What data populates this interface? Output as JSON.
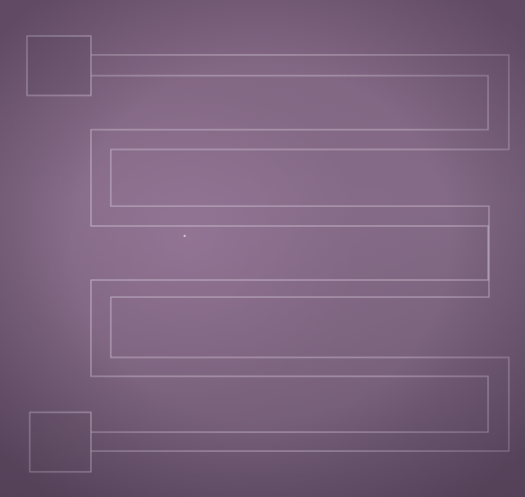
{
  "scene": {
    "subject": "meander",
    "colors": {
      "background": "#7a5f78",
      "trace": "#e1d7e6"
    }
  }
}
